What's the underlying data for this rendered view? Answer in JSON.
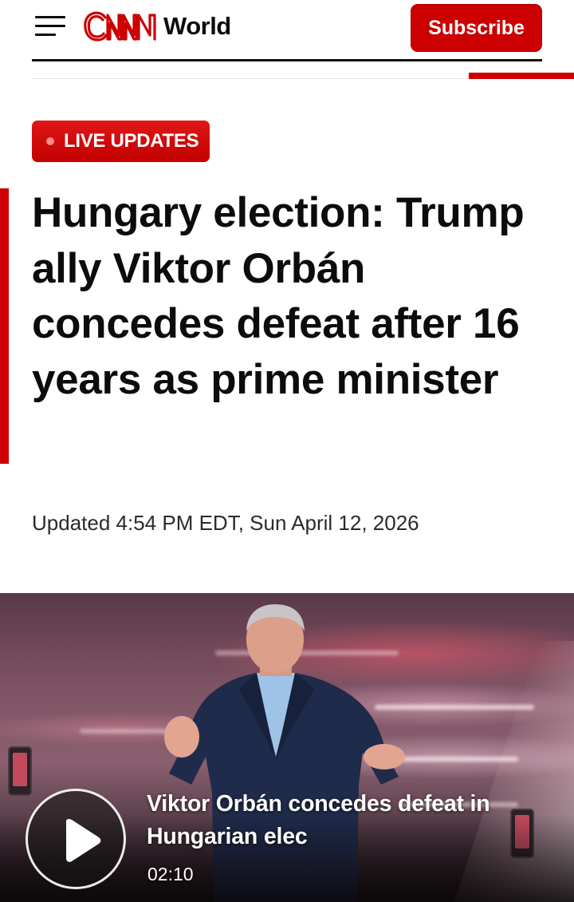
{
  "header": {
    "brand": "CNN",
    "edition": "World",
    "subscribe_label": "Subscribe",
    "brand_color": "#cc0000"
  },
  "article": {
    "badge": "LIVE UPDATES",
    "headline": "Hungary election: Trump ally Viktor Orbán concedes defeat after 16 years as prime minister",
    "timestamp": "Updated 4:54 PM EDT, Sun April 12, 2026"
  },
  "video": {
    "title": "Viktor Orbán concedes defeat in Hungarian elec",
    "duration": "02:10",
    "play_icon": "play-icon"
  }
}
